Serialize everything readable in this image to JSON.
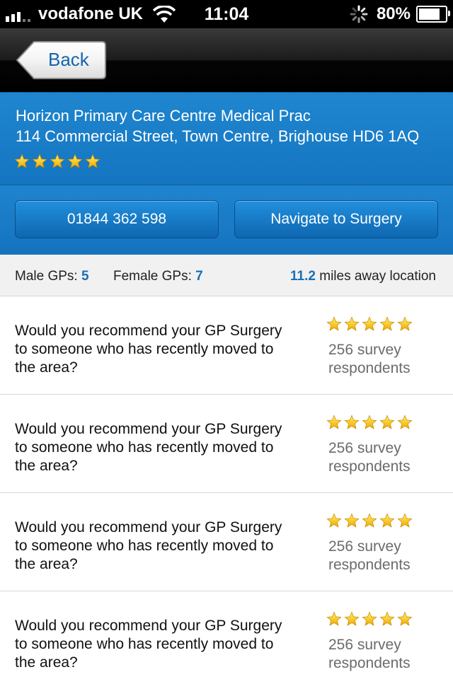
{
  "status_bar": {
    "carrier": "vodafone UK",
    "time": "11:04",
    "battery": "80%",
    "battery_level": 0.8
  },
  "nav": {
    "back_label": "Back"
  },
  "practice": {
    "name": "Horizon Primary Care Centre Medical Prac",
    "address": "114 Commercial Street, Town Centre, Brighouse HD6 1AQ",
    "rating": 5,
    "max_rating": 5
  },
  "actions": {
    "call_label": "01844 362 598",
    "navigate_label": "Navigate to Surgery"
  },
  "stats": {
    "male_label": "Male GPs:",
    "male_value": "5",
    "female_label": "Female GPs:",
    "female_value": "7",
    "distance_value": "11.2",
    "distance_label": "miles away location"
  },
  "survey": [
    {
      "question": "Would you recommend your GP Surgery to someone who has recently moved to the area?",
      "rating": 5,
      "respondents": "256 survey respondents"
    },
    {
      "question": "Would you recommend your GP Surgery to someone who has recently moved to the area?",
      "rating": 5,
      "respondents": "256 survey respondents"
    },
    {
      "question": "Would you recommend your GP Surgery to someone who has recently moved to the area?",
      "rating": 5,
      "respondents": "256 survey respondents"
    },
    {
      "question": "Would you recommend your GP Surgery to someone who has recently moved to the area?",
      "rating": 5,
      "respondents": "256 survey respondents"
    }
  ],
  "colors": {
    "header_blue": "#1f86cf",
    "accent_value": "#1a6fb5",
    "star_gold": "#ffd21a"
  }
}
